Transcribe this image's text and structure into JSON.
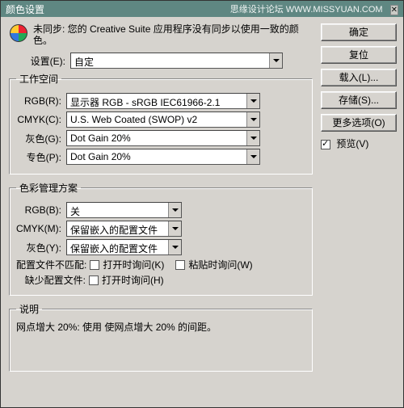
{
  "title": "颜色设置",
  "watermark": "思缘设计论坛  WWW.MISSYUAN.COM",
  "sync_text": "未同步: 您的 Creative Suite 应用程序没有同步以使用一致的颜色。",
  "settings": {
    "label": "设置(E):",
    "value": "自定"
  },
  "workspace": {
    "legend": "工作空间",
    "rgb": {
      "label": "RGB(R):",
      "value": "显示器 RGB - sRGB IEC61966-2.1"
    },
    "cmyk": {
      "label": "CMYK(C):",
      "value": "U.S. Web Coated (SWOP) v2"
    },
    "gray": {
      "label": "灰色(G):",
      "value": "Dot Gain 20%"
    },
    "spot": {
      "label": "专色(P):",
      "value": "Dot Gain 20%"
    }
  },
  "policy": {
    "legend": "色彩管理方案",
    "rgb": {
      "label": "RGB(B):",
      "value": "关"
    },
    "cmyk": {
      "label": "CMYK(M):",
      "value": "保留嵌入的配置文件"
    },
    "gray": {
      "label": "灰色(Y):",
      "value": "保留嵌入的配置文件"
    },
    "mismatch_label": "配置文件不匹配:",
    "mismatch_open": "打开时询问(K)",
    "mismatch_paste": "粘贴时询问(W)",
    "missing_label": "缺少配置文件:",
    "missing_open": "打开时询问(H)"
  },
  "description": {
    "legend": "说明",
    "text": "网点增大 20%: 使用 使网点增大 20% 的间距。"
  },
  "buttons": {
    "ok": "确定",
    "reset": "复位",
    "load": "载入(L)...",
    "save": "存储(S)...",
    "more": "更多选项(O)"
  },
  "preview": {
    "label": "预览(V)",
    "checked": true
  }
}
